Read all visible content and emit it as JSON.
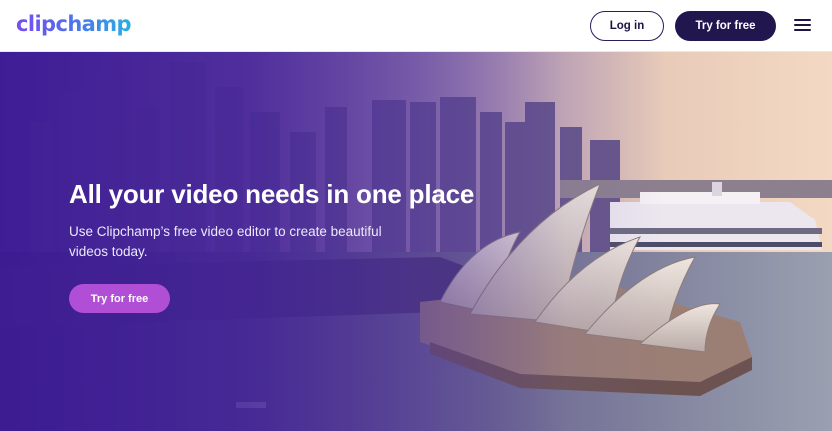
{
  "header": {
    "logo_text": "clipchamp",
    "login_label": "Log in",
    "try_label": "Try for free",
    "menu_icon": "hamburger-menu-icon"
  },
  "hero": {
    "title": "All your video needs in one place",
    "subtitle": "Use Clipchamp’s free video editor to create beautiful videos today.",
    "cta_label": "Try for free",
    "background_image": "sydney-opera-house-aerial-sunset"
  },
  "colors": {
    "brand_dark": "#22164f",
    "cta_purple": "#b04fd6",
    "overlay_purple": "#3e1c96"
  }
}
